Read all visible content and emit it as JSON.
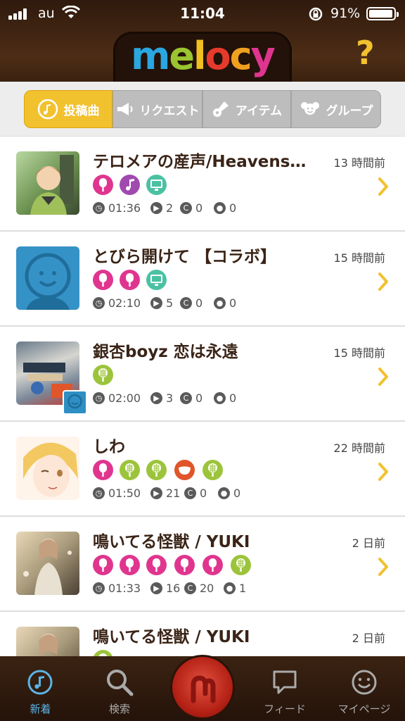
{
  "status_bar": {
    "carrier": "au",
    "time": "11:04",
    "battery": "91%",
    "battery_level": 0.91
  },
  "header": {
    "logo_text": "melocy",
    "help_label": "?"
  },
  "segments": [
    {
      "label": "投稿曲",
      "icon": "music-note-icon",
      "active": true
    },
    {
      "label": "リクエスト",
      "icon": "megaphone-icon",
      "active": false
    },
    {
      "label": "アイテム",
      "icon": "guitar-icon",
      "active": false
    },
    {
      "label": "グループ",
      "icon": "group-icon",
      "active": false
    }
  ],
  "songs": [
    {
      "title": "テロメアの産声/Heavens…",
      "age": "13 時間前",
      "duration": "01:36",
      "plays": "2",
      "comments": "0",
      "messages": "0",
      "badges": [
        "mic-pink",
        "note-purple",
        "monitor-teal"
      ]
    },
    {
      "title": "とびら開けて 【コラボ】",
      "age": "15 時間前",
      "duration": "02:10",
      "plays": "5",
      "comments": "0",
      "messages": "0",
      "badges": [
        "mic-pink",
        "mic-pink",
        "monitor-teal"
      ]
    },
    {
      "title": "銀杏boyz  恋は永遠",
      "age": "15 時間前",
      "duration": "02:00",
      "plays": "3",
      "comments": "0",
      "messages": "0",
      "badges": [
        "mic-green"
      ]
    },
    {
      "title": "しわ",
      "age": "22 時間前",
      "duration": "01:50",
      "plays": "21",
      "comments": "0",
      "messages": "0",
      "badges": [
        "mic-pink",
        "mic-green",
        "mic-green",
        "cup-orange",
        "mic-green"
      ]
    },
    {
      "title": "鳴いてる怪獣 / YUKI",
      "age": "2 日前",
      "duration": "01:33",
      "plays": "16",
      "comments": "20",
      "messages": "1",
      "badges": [
        "mic-pink",
        "mic-pink",
        "mic-pink",
        "mic-pink",
        "mic-pink",
        "mic-green"
      ]
    },
    {
      "title": "鳴いてる怪獣 / YUKI",
      "age": "2 日前",
      "duration": "",
      "plays": "",
      "comments": "",
      "messages": "",
      "badges": [
        "mic-green"
      ]
    }
  ],
  "tab_bar": [
    {
      "label": "新着",
      "icon": "music-note-icon",
      "active": true
    },
    {
      "label": "検索",
      "icon": "search-icon",
      "active": false
    },
    {
      "label": "",
      "icon": "record-icon",
      "active": false
    },
    {
      "label": "フィード",
      "icon": "speech-bubble-icon",
      "active": false
    },
    {
      "label": "マイページ",
      "icon": "smiley-icon",
      "active": false
    }
  ],
  "colors": {
    "header_brown": "#3a2210",
    "accent_yellow": "#f2c12e",
    "mic_pink": "#e0358f",
    "mic_green": "#9cc43b",
    "note_purple": "#a04ab0",
    "monitor_teal": "#4bc1a3",
    "cup_orange": "#e0552a",
    "tab_active": "#5bb4e6"
  }
}
